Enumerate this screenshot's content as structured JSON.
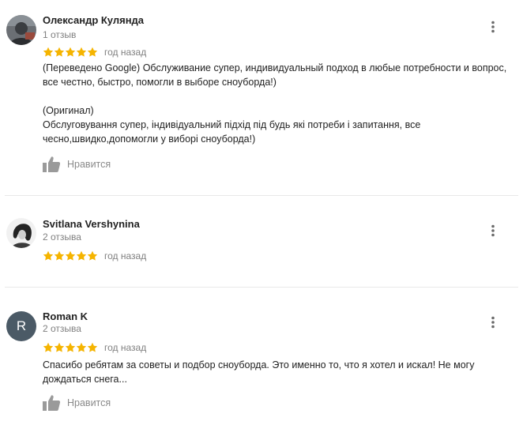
{
  "icons": {
    "star": "star-icon",
    "menu": "more-vert-icon",
    "like": "thumbs-up-icon"
  },
  "colors": {
    "star": "#f5b400",
    "secondary_text": "#808080",
    "avatar_letter_bg": "#4b5a66",
    "divider": "#e8e8e8"
  },
  "reviews": [
    {
      "author": "Олександр Кулянда",
      "review_count": "1 отзыв",
      "rating": 5,
      "date": "год назад",
      "translated_text": "(Переведено Google) Обслуживание супер, индивидуальный подход в любые потребности и вопрос, все честно, быстро, помогли в выборе сноуборда!)",
      "original_label": "(Оригинал)",
      "original_text": "Обслуговування супер, індивідуальний підхід під будь які потреби і запитання, все чесно,швидко,допомогли у виборі сноуборда!)",
      "like_label": "Нравится"
    },
    {
      "author": "Svitlana Vershynina",
      "review_count": "2 отзыва",
      "rating": 5,
      "date": "год назад"
    },
    {
      "author": "Roman K",
      "avatar_letter": "R",
      "review_count": "2 отзыва",
      "rating": 5,
      "date": "год назад",
      "text": "Спасибо ребятам за советы и подбор сноуборда. Это именно то, что я хотел и искал! Не могу дождаться снега...",
      "like_label": "Нравится"
    }
  ]
}
